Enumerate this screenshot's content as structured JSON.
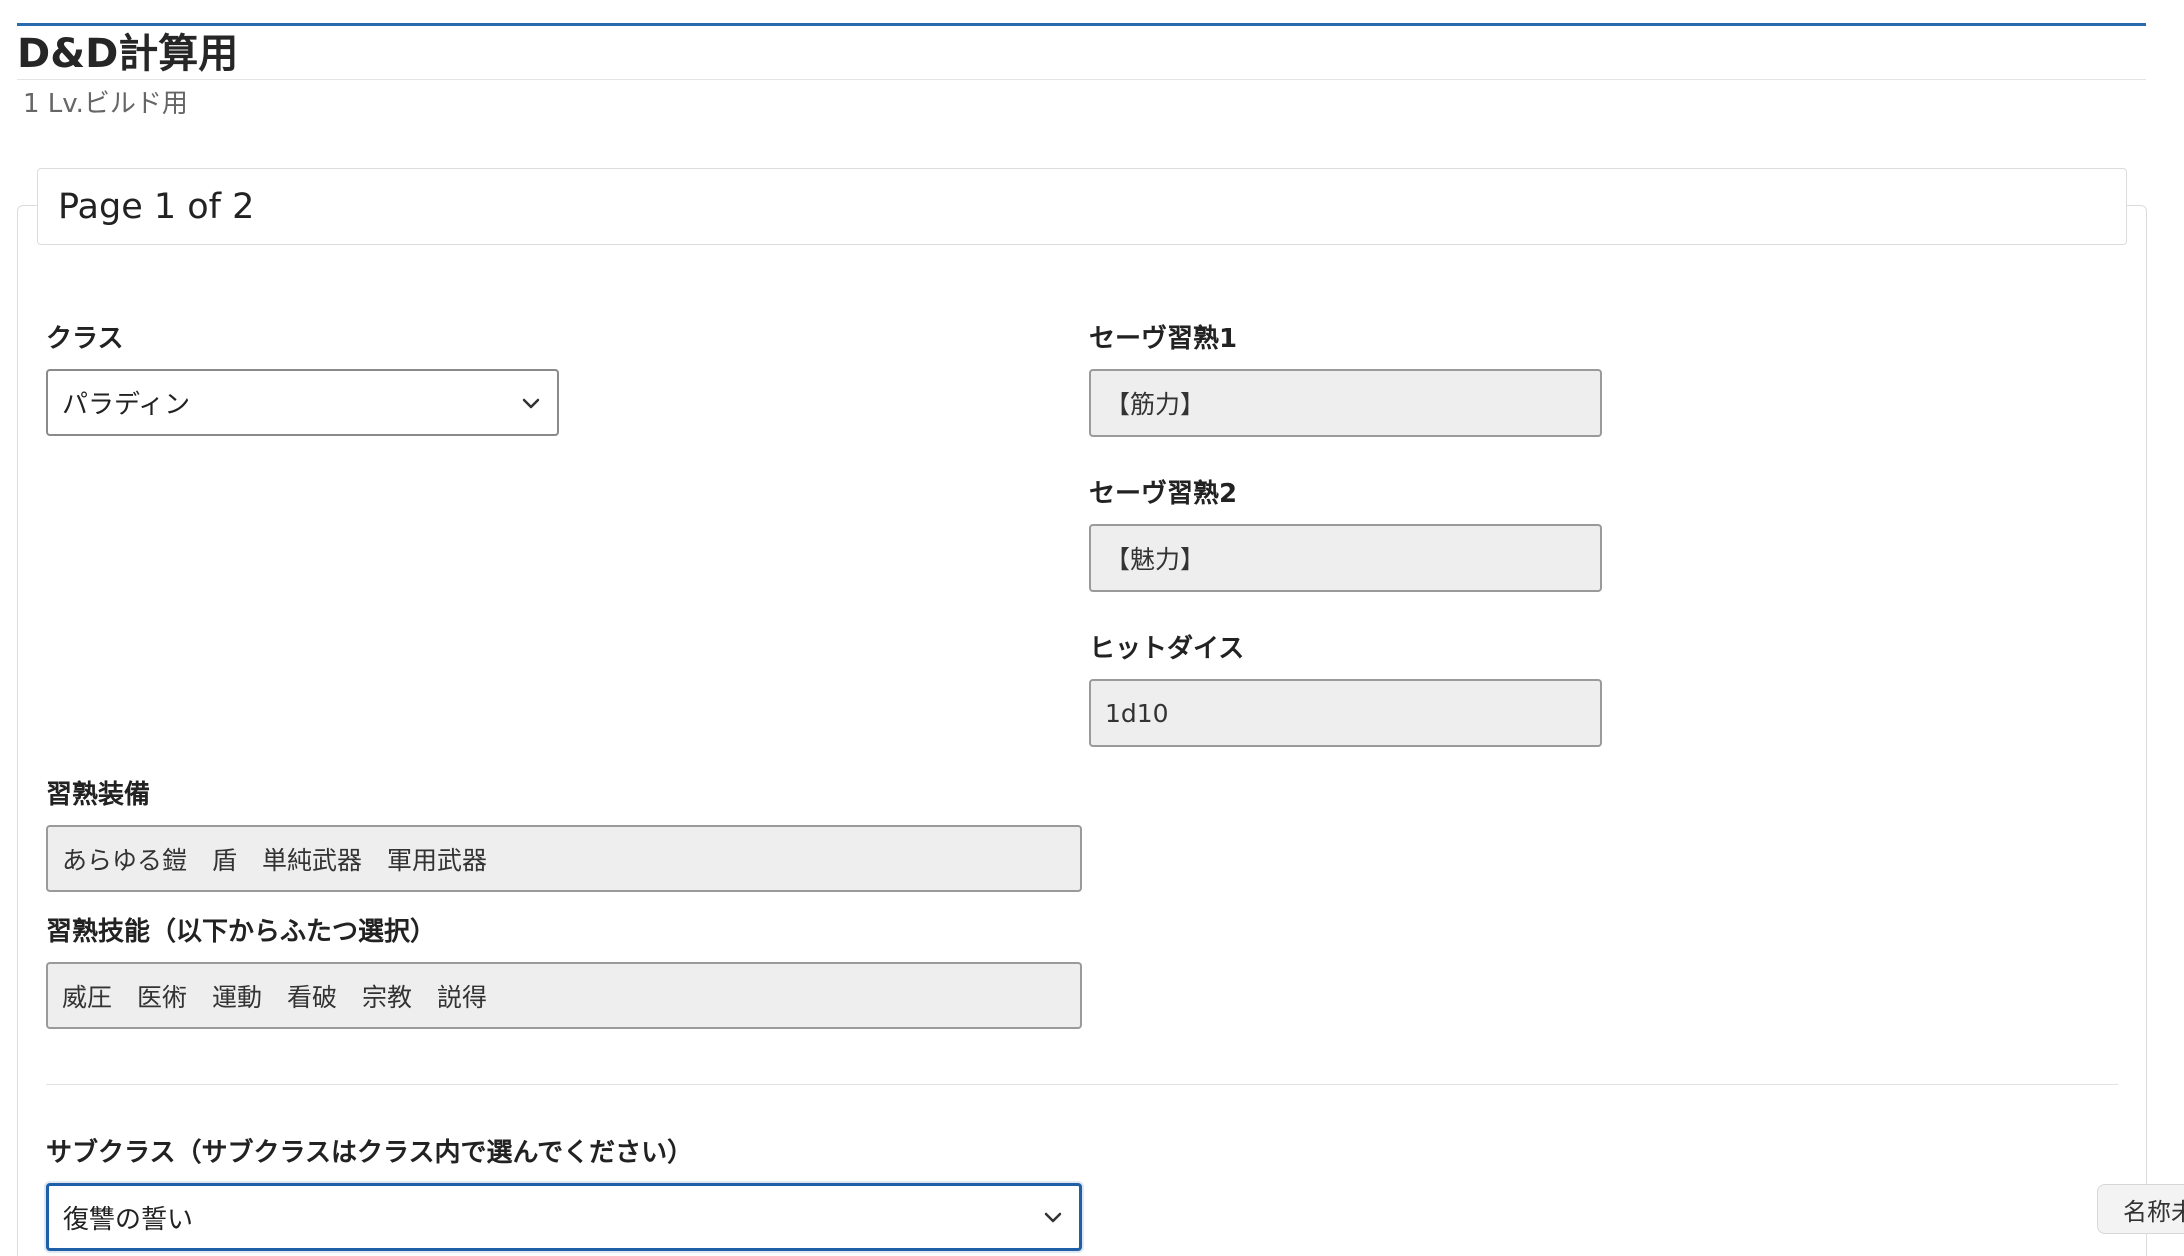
{
  "header": {
    "title": "D&D計算用",
    "subtitle": "1 Lv.ビルド用"
  },
  "card": {
    "header_title": "Page 1 of 2"
  },
  "fields": {
    "class": {
      "label": "クラス",
      "value": "パラディン"
    },
    "save1": {
      "label": "セーヴ習熟1",
      "value": "【筋力】"
    },
    "save2": {
      "label": "セーヴ習熟2",
      "value": "【魅力】"
    },
    "hit_dice": {
      "label": "ヒットダイス",
      "value": "1d10"
    },
    "equipment": {
      "label": "習熟装備",
      "value": "あらゆる鎧　盾　単純武器　軍用武器"
    },
    "skills": {
      "label": "習熟技能（以下からふたつ選択）",
      "value": "威圧　医術　運動　看破　宗教　説得"
    },
    "subclass": {
      "label": "サブクラス（サブクラスはクラス内で選んでください）",
      "value": "復讐の誓い"
    }
  },
  "floating_tab": {
    "label": "名称未"
  },
  "colors": {
    "accent": "#2a6bb0",
    "focus": "#1f5fa8",
    "readonly_bg": "#eeeeee"
  }
}
